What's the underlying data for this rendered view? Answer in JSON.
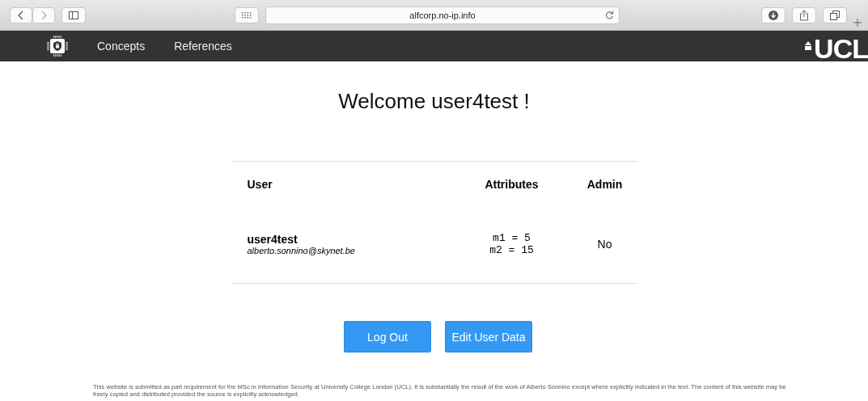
{
  "browser": {
    "url": "alfcorp.no-ip.info"
  },
  "nav": {
    "items": [
      "Concepts",
      "References"
    ],
    "brand": "UCL"
  },
  "heading": "Welcome user4test !",
  "table": {
    "columns": [
      "User",
      "Attributes",
      "Admin"
    ],
    "rows": [
      {
        "name": "user4test",
        "email": "alberto.sonnino@skynet.be",
        "attributes": [
          "m1 = 5",
          "m2 = 15"
        ],
        "admin": "No"
      }
    ]
  },
  "buttons": [
    "Log Out",
    "Edit User Data"
  ],
  "footer": "This website is submitted as part requirement for the MSc in Information Security at University College London (UCL). It is substantially the result of the work of Alberto Sonnino except where explicitly indicated in the text. The content of this website may be freely copied and distributed provided the source is explicitly acknowledged."
}
